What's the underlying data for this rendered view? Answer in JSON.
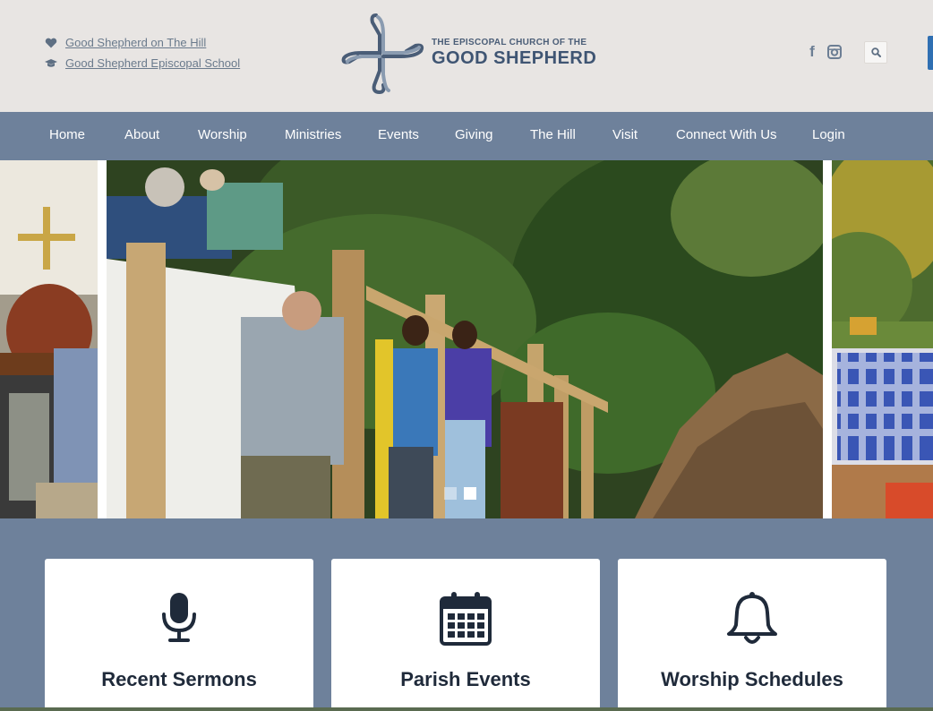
{
  "header": {
    "links": [
      {
        "label": "Good Shepherd on The Hill",
        "icon": "heart-icon"
      },
      {
        "label": "Good Shepherd Episcopal School",
        "icon": "graduation-cap-icon"
      }
    ],
    "logo": {
      "line1": "THE EPISCOPAL CHURCH OF THE",
      "line2": "GOOD SHEPHERD"
    },
    "social": {
      "facebook_label": "f",
      "instagram_icon": "instagram-icon"
    },
    "search_icon": "search-icon"
  },
  "nav": {
    "items": [
      "Home",
      "About",
      "Worship",
      "Ministries",
      "Events",
      "Giving",
      "The Hill",
      "Visit",
      "Connect With Us",
      "Login"
    ]
  },
  "slider": {
    "slide_count": 2,
    "active_index": 1
  },
  "cards": [
    {
      "title": "Recent Sermons",
      "icon": "microphone-icon"
    },
    {
      "title": "Parish Events",
      "icon": "calendar-icon"
    },
    {
      "title": "Worship Schedules",
      "icon": "bell-icon"
    }
  ],
  "colors": {
    "header_bg": "#e8e5e3",
    "nav_bg": "#6e819b",
    "brand_navy": "#3f5573",
    "card_title": "#1f2a3a"
  }
}
